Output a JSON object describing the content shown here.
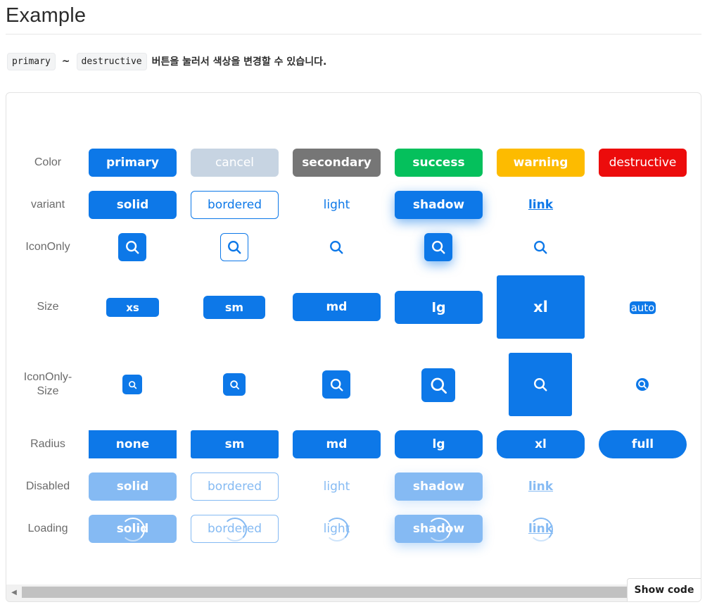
{
  "heading": "Example",
  "description": {
    "code_from": "primary",
    "tilde": "~",
    "code_to": "destructive",
    "text": "버튼을 눌러서 색상을 변경할 수 있습니다."
  },
  "rows": {
    "color": "Color",
    "variant": "variant",
    "icononly": "IconOnly",
    "size": "Size",
    "icononly_size_line1": "IconOnly-",
    "icononly_size_line2": "Size",
    "radius": "Radius",
    "disabled": "Disabled",
    "loading": "Loading"
  },
  "color_buttons": [
    "primary",
    "cancel",
    "secondary",
    "success",
    "warning",
    "destructive"
  ],
  "variant_buttons": [
    "solid",
    "bordered",
    "light",
    "shadow",
    "link"
  ],
  "size_buttons": [
    "xs",
    "sm",
    "md",
    "lg",
    "xl",
    "auto"
  ],
  "radius_buttons": [
    "none",
    "sm",
    "md",
    "lg",
    "xl",
    "full"
  ],
  "disabled_buttons": [
    "solid",
    "bordered",
    "light",
    "shadow",
    "link"
  ],
  "loading_buttons": [
    "solid",
    "bordered",
    "light",
    "shadow",
    "link"
  ],
  "icons": {
    "search": "search-icon",
    "arrow": "◀"
  },
  "colors": {
    "primary": "#0d78e8",
    "cancel": "#c7d4e2",
    "secondary": "#767676",
    "success": "#05c05c",
    "warning": "#fdbb00",
    "destructive": "#ec0c0c"
  },
  "show_code": "Show code"
}
